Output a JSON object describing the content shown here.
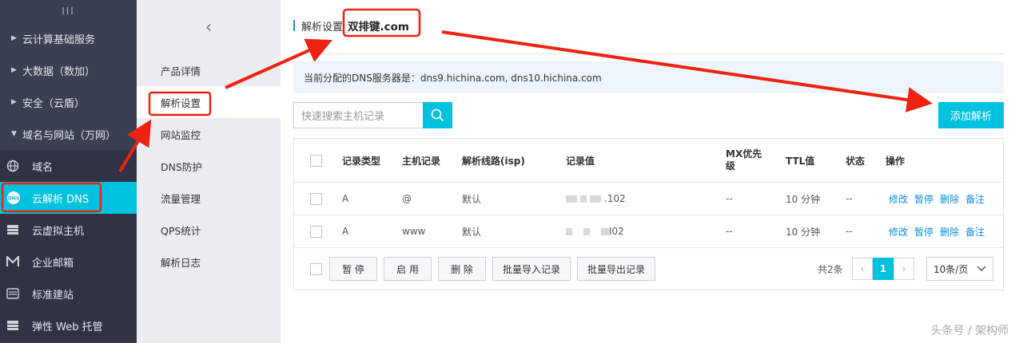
{
  "nav": {
    "toggle": "III",
    "groups": [
      {
        "label": "云计算基础服务"
      },
      {
        "label": "大数据（数加）"
      },
      {
        "label": "安全（云盾）"
      },
      {
        "label": "域名与网站（万网）"
      }
    ],
    "items": [
      {
        "label": "域名"
      },
      {
        "label": "云解析 DNS"
      },
      {
        "label": "云虚拟主机"
      },
      {
        "label": "企业邮箱"
      },
      {
        "label": "标准建站"
      },
      {
        "label": "弹性 Web 托管"
      }
    ]
  },
  "side2": {
    "back_icon": "‹",
    "items": [
      {
        "label": "产品详情"
      },
      {
        "label": "解析设置"
      },
      {
        "label": "网站监控"
      },
      {
        "label": "DNS防护"
      },
      {
        "label": "流量管理"
      },
      {
        "label": "QPS统计"
      },
      {
        "label": "解析日志"
      }
    ]
  },
  "main": {
    "breadcrumb": "解析设置",
    "domain": "双排键.com",
    "notice": "当前分配的DNS服务器是：dns9.hichina.com, dns10.hichina.com",
    "search_placeholder": "快速搜索主机记录",
    "add_button": "添加解析",
    "table": {
      "headers": [
        "记录类型",
        "主机记录",
        "解析线路(isp)",
        "记录值",
        "MX优先级",
        "TTL值",
        "状态",
        "操作"
      ],
      "rows": [
        {
          "type": "A",
          "host": "@",
          "line": "默认",
          "value": ".102",
          "mx": "--",
          "ttl": "10 分钟",
          "status": "--"
        },
        {
          "type": "A",
          "host": "www",
          "line": "默认",
          "value": "I02",
          "mx": "--",
          "ttl": "10 分钟",
          "status": "--"
        }
      ],
      "ops": [
        "修改",
        "暂停",
        "删除",
        "备注"
      ]
    },
    "footer": {
      "buttons": [
        "暂 停",
        "启 用",
        "删 除",
        "批量导入记录",
        "批量导出记录"
      ],
      "total": "共2条",
      "current_page": "1",
      "page_size": "10条/页"
    }
  },
  "watermark": "头条号 / 架构师",
  "colors": {
    "accent": "#00c1de",
    "nav_bg": "#3a3f51",
    "annotation": "#ee2211"
  }
}
